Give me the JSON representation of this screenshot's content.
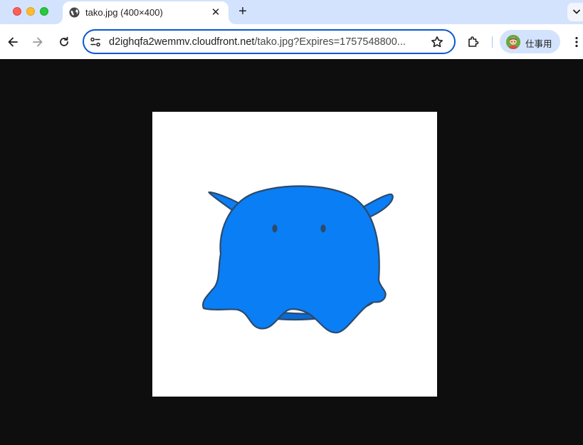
{
  "window": {
    "traffic_lights": [
      "close",
      "minimize",
      "zoom"
    ]
  },
  "tabs": [
    {
      "title": "tako.jpg (400×400)",
      "favicon": "globe-icon",
      "active": true
    }
  ],
  "tab_strip": {
    "close_glyph": "✕",
    "new_tab_glyph": "+"
  },
  "toolbar": {
    "url_host": "d2ighqfa2wemmv.cloudfront.net",
    "url_rest": "/tako.jpg?Expires=1757548800...",
    "profile_label": "仕事用"
  },
  "image": {
    "file": "tako.jpg",
    "subject": "blue cartoon octopus",
    "fill_color": "#0a7ef5",
    "outline_color": "#2d4a6b"
  },
  "colors": {
    "tabstrip_bg": "#d3e3fd",
    "accent": "#0b57d0",
    "viewer_bg": "#0e0e0e"
  }
}
